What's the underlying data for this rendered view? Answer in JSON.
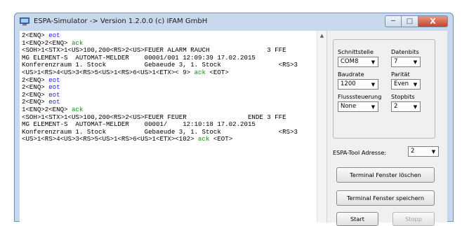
{
  "window": {
    "title": "ESPA-Simulator -> Version 1.2.0.0   (c) IFAM GmbH",
    "controls": {
      "minimize": "─",
      "maximize": "□",
      "close": "X"
    }
  },
  "terminal": {
    "lines": [
      [
        {
          "t": "2<ENQ> ",
          "c": "k"
        },
        {
          "t": "eot",
          "c": "b"
        }
      ],
      [
        {
          "t": "1<ENQ>2<ENQ> ",
          "c": "k"
        },
        {
          "t": "ack",
          "c": "g"
        }
      ],
      [
        {
          "t": "<SOH>1<STX>1<US>100,200<RS>2<US>FEUER ALARM RAUCH               3 FFE",
          "c": "k"
        }
      ],
      [
        {
          "t": "MG ELEMENT-S  AUTOMAT-MELDER    00001/001 12:09:39 17.02.2015",
          "c": "k"
        }
      ],
      [
        {
          "t": "Konferenzraum 1. Stock          Gebaeude 3, 1. Stock               <RS>3",
          "c": "k"
        }
      ],
      [
        {
          "t": "<US>1<RS>4<US>3<RS>5<US>1<RS>6<US>1<ETX>< 9> ",
          "c": "k"
        },
        {
          "t": "ack",
          "c": "g"
        },
        {
          "t": " <EOT>",
          "c": "k"
        }
      ],
      [
        {
          "t": "2<ENQ> ",
          "c": "k"
        },
        {
          "t": "eot",
          "c": "b"
        }
      ],
      [
        {
          "t": "2<ENQ> ",
          "c": "k"
        },
        {
          "t": "eot",
          "c": "b"
        }
      ],
      [
        {
          "t": "2<ENQ> ",
          "c": "k"
        },
        {
          "t": "eot",
          "c": "b"
        }
      ],
      [
        {
          "t": "2<ENQ> ",
          "c": "k"
        },
        {
          "t": "eot",
          "c": "b"
        }
      ],
      [
        {
          "t": "1<ENQ>2<ENQ> ",
          "c": "k"
        },
        {
          "t": "ack",
          "c": "g"
        }
      ],
      [
        {
          "t": "<SOH>1<STX>1<US>100,200<RS>2<US>FEUER FEUER                ENDE 3 FFE",
          "c": "k"
        }
      ],
      [
        {
          "t": "MG ELEMENT-S  AUTOMAT-MELDER    00001/    12:10:18 17.02.2015",
          "c": "k"
        }
      ],
      [
        {
          "t": "Konferenzraum 1. Stock          Gebaeude 3, 1. Stock               <RS>3",
          "c": "k"
        }
      ],
      [
        {
          "t": "<US>1<RS>4<US>3<RS>5<US>1<RS>6<US>1<ETX><102> ",
          "c": "k"
        },
        {
          "t": "ack",
          "c": "g"
        },
        {
          "t": " <EOT>",
          "c": "k"
        }
      ]
    ],
    "scroll_up_glyph": "▲"
  },
  "settings": {
    "schnittstelle": {
      "label": "Schnittstelle",
      "value": "COM8"
    },
    "datenbits": {
      "label": "Datenbits",
      "value": "7"
    },
    "baudrate": {
      "label": "Baudrate",
      "value": "1200"
    },
    "paritaet": {
      "label": "Parität",
      "value": "Even"
    },
    "flusssteuerung": {
      "label": "Flusssteuerung",
      "value": "None"
    },
    "stopbits": {
      "label": "Stopbits",
      "value": "2"
    },
    "dropdown_glyph": "▼"
  },
  "espa_adresse": {
    "label": "ESPA-Tool Adresse:",
    "value": "2"
  },
  "buttons": {
    "clear": "Terminal Fenster löschen",
    "save": "Terminal Fenster speichern",
    "start": "Start",
    "stop": "Stopp"
  },
  "colors": {
    "text": "#000000",
    "eot": "#1b22d8",
    "ack": "#1d8f1d"
  }
}
